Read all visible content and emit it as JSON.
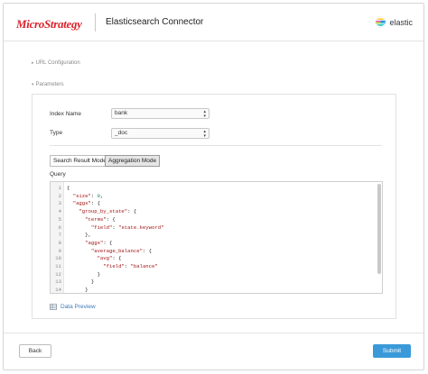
{
  "header": {
    "brand_logo": "MicroStrategy",
    "title": "Elasticsearch Connector",
    "partner_logo": "elastic"
  },
  "sections": {
    "url_config": "URL Configuration",
    "parameters": "Parameters"
  },
  "form": {
    "index_name_label": "Index Name",
    "index_name_value": "bank",
    "type_label": "Type",
    "type_value": "_doc"
  },
  "modes": {
    "search_result": "Search Result Mode",
    "aggregation": "Aggregation Mode",
    "selected": "aggregation"
  },
  "query": {
    "label": "Query",
    "lines": [
      {
        "num": "1",
        "text": "{"
      },
      {
        "num": "2",
        "text": "  \"size\": 0,"
      },
      {
        "num": "3",
        "text": "  \"aggs\": {"
      },
      {
        "num": "4",
        "text": "    \"group_by_state\": {"
      },
      {
        "num": "5",
        "text": "      \"terms\": {"
      },
      {
        "num": "6",
        "text": "        \"field\": \"state.keyword\""
      },
      {
        "num": "7",
        "text": "      },"
      },
      {
        "num": "8",
        "text": "      \"aggs\": {"
      },
      {
        "num": "9",
        "text": "        \"average_balance\": {"
      },
      {
        "num": "10",
        "text": "          \"avg\": {"
      },
      {
        "num": "11",
        "text": "            \"field\": \"balance\""
      },
      {
        "num": "12",
        "text": "          }"
      },
      {
        "num": "13",
        "text": "        }"
      },
      {
        "num": "14",
        "text": "      }"
      },
      {
        "num": "15",
        "text": "    }"
      }
    ]
  },
  "data_preview": "Data Preview",
  "footer": {
    "back": "Back",
    "submit": "Submit"
  },
  "colors": {
    "brand_red": "#d9232e",
    "link_blue": "#3c79b8",
    "submit_blue": "#3a9ad9",
    "json_key": "#a31515",
    "json_number": "#098658"
  }
}
